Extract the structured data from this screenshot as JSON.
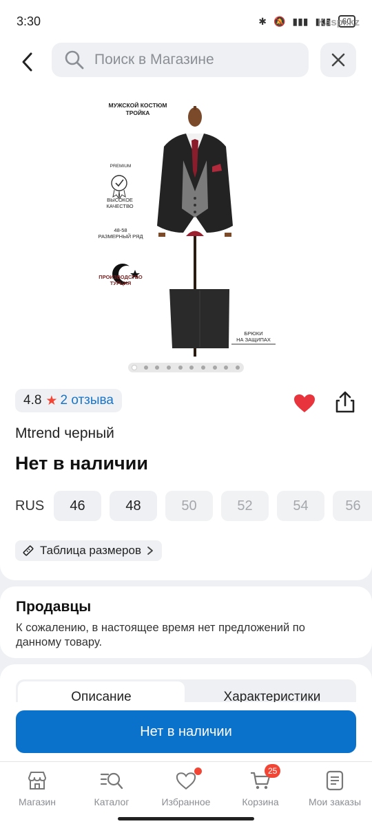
{
  "status_bar": {
    "time": "3:30",
    "battery": "60",
    "watermark": "Kaspi.kz"
  },
  "header": {
    "search_placeholder": "Поиск в Магазине"
  },
  "product_image": {
    "title_line1": "МУЖСКОЙ КОСТЮМ",
    "title_line2": "ТРОЙКА",
    "premium": "PREMIUM",
    "quality_line1": "ВЫСОКОЕ",
    "quality_line2": "КАЧЕСТВО",
    "sizes_line1": "48-58",
    "sizes_line2": "РАЗМЕРНЫЙ РЯД",
    "production_line1": "ПРОИЗВОДСТВО",
    "production_line2": "ТУРЦИЯ",
    "pants_line1": "БРЮКИ",
    "pants_line2": "НА ЗАЩИПАХ",
    "slide_count": 10,
    "active_slide": 1
  },
  "rating": {
    "score": "4.8",
    "reviews": "2 отзыва"
  },
  "product": {
    "title": "Mtrend черный",
    "availability": "Нет в наличии"
  },
  "sizes": {
    "label": "RUS",
    "items": [
      {
        "value": "46",
        "available": true
      },
      {
        "value": "48",
        "available": true
      },
      {
        "value": "50",
        "available": false
      },
      {
        "value": "52",
        "available": false
      },
      {
        "value": "54",
        "available": false
      },
      {
        "value": "56",
        "available": false
      }
    ]
  },
  "size_table_label": "Таблица размеров",
  "sellers": {
    "title": "Продавцы",
    "text": "К сожалению, в настоящее время нет предложений по данному товару."
  },
  "tabs": {
    "description": "Описание",
    "specs": "Характеристики"
  },
  "cta": {
    "label": "Нет в наличии"
  },
  "nav": {
    "items": [
      {
        "label": "Магазин",
        "icon": "shop-icon"
      },
      {
        "label": "Каталог",
        "icon": "catalog-search-icon"
      },
      {
        "label": "Избранное",
        "icon": "heart-icon",
        "has_dot": true
      },
      {
        "label": "Корзина",
        "icon": "cart-icon",
        "badge": "25"
      },
      {
        "label": "Мои заказы",
        "icon": "orders-icon"
      }
    ]
  },
  "colors": {
    "accent": "#0b72cc",
    "heart": "#e8343d",
    "badge": "#f14635",
    "link": "#1874c9"
  }
}
